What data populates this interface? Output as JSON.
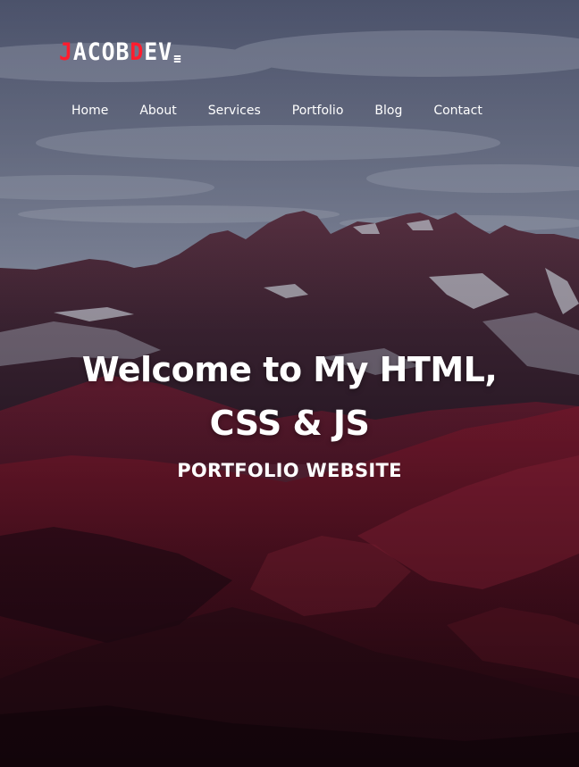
{
  "brand": {
    "logo_first": "J",
    "logo_mid": "ACOB",
    "logo_second": "D",
    "logo_last": "EV",
    "accent_color": "#ff1d2e",
    "menu_icon": "hamburger-icon"
  },
  "nav": {
    "items": [
      {
        "label": "Home"
      },
      {
        "label": "About"
      },
      {
        "label": "Services"
      },
      {
        "label": "Portfolio"
      },
      {
        "label": "Blog"
      },
      {
        "label": "Contact"
      }
    ]
  },
  "hero": {
    "headline_line1": "Welcome to My HTML,",
    "headline_line2": "CSS & JS",
    "subheading": "PORTFOLIO WEBSITE",
    "background": "mountain-landscape-image"
  }
}
